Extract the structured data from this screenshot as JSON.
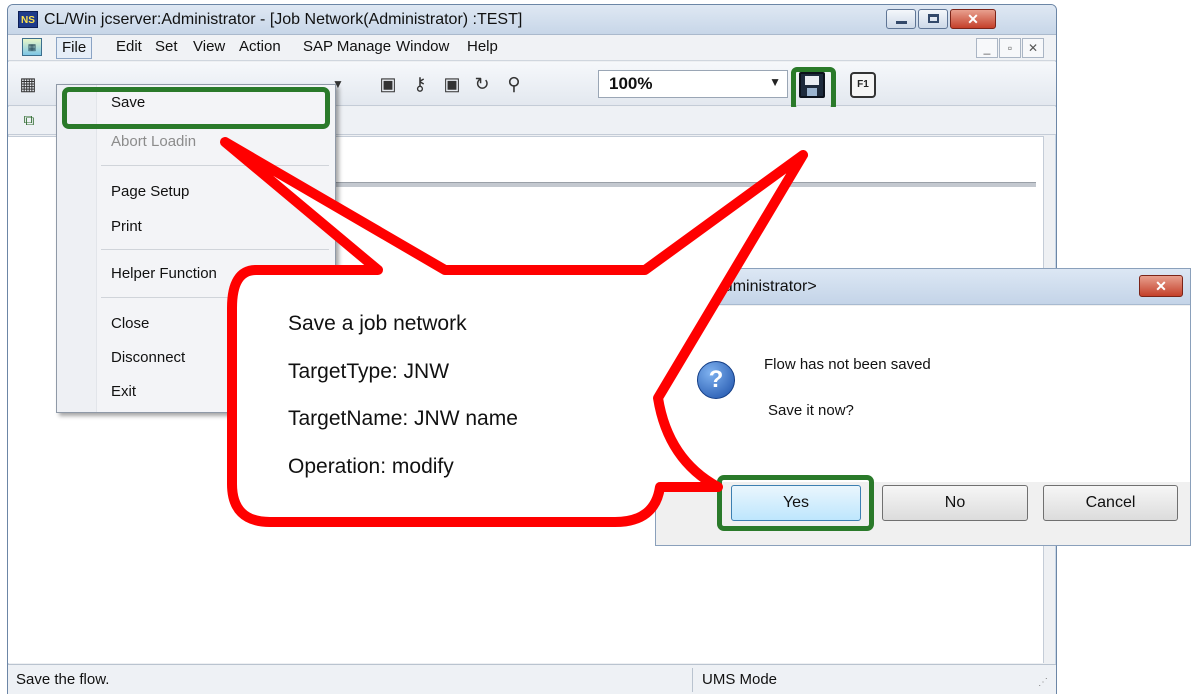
{
  "window": {
    "title": "CL/Win jcserver:Administrator - [Job Network(Administrator) :TEST]",
    "icon_text": "NS",
    "controls": [
      "minimize-icon",
      "maximize-icon",
      "close-icon"
    ],
    "close_glyph": "✕"
  },
  "menu": {
    "items": [
      "File",
      "Edit",
      "Set",
      "View",
      "Action",
      "SAP Manage",
      "Window",
      "Help"
    ],
    "mdi_controls": [
      "_",
      "▫",
      "✕"
    ]
  },
  "toolbar": {
    "zoom_value": "100%",
    "zoom_arrow": "▼",
    "f1_label": "F1"
  },
  "file_menu": {
    "items": [
      {
        "label": "Save",
        "enabled": true
      },
      {
        "label": "Abort Loadin",
        "enabled": false
      },
      {
        "label": "Page Setup",
        "enabled": true
      },
      {
        "label": "Print",
        "enabled": true
      },
      {
        "label": "Helper Function",
        "enabled": true
      },
      {
        "label": "Close",
        "enabled": true
      },
      {
        "label": "Disconnect",
        "enabled": true
      },
      {
        "label": "Exit",
        "enabled": true
      }
    ]
  },
  "dialog": {
    "title": "T<Administrator>",
    "close_glyph": "✕",
    "message1": "Flow has not been saved",
    "message2": "Save it now?",
    "buttons": {
      "yes": "Yes",
      "no": "No",
      "cancel": "Cancel"
    }
  },
  "callout": {
    "lines": [
      "Save a job network",
      "TargetType: JNW",
      "TargetName: JNW name",
      "Operation: modify"
    ],
    "fill_color": "#ff0000"
  },
  "status": {
    "text": "Save the flow.",
    "mode": "UMS Mode"
  },
  "colors": {
    "highlight": "#2a7a2a",
    "callout_border": "#ff0000"
  }
}
